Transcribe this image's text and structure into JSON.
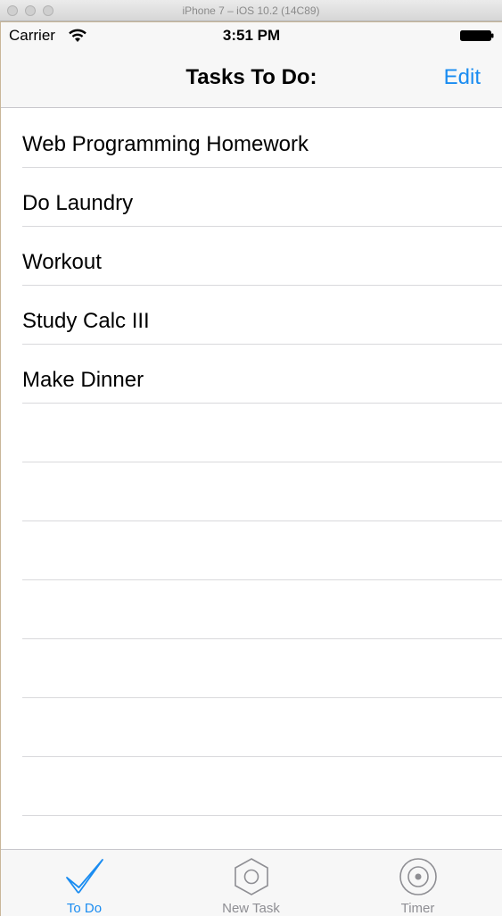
{
  "simulator": {
    "title": "iPhone 7 – iOS 10.2 (14C89)"
  },
  "status_bar": {
    "carrier": "Carrier",
    "time": "3:51 PM"
  },
  "nav_bar": {
    "title": "Tasks To Do:",
    "edit_label": "Edit"
  },
  "tasks": [
    "Web Programming Homework",
    "Do Laundry",
    "Workout",
    "Study Calc III",
    "Make Dinner"
  ],
  "tab_bar": {
    "tabs": [
      {
        "label": "To Do",
        "icon": "checkmark-icon",
        "active": true
      },
      {
        "label": "New Task",
        "icon": "hexagon-icon",
        "active": false
      },
      {
        "label": "Timer",
        "icon": "target-icon",
        "active": false
      }
    ]
  },
  "colors": {
    "accent": "#1a8cf1",
    "inactive_tab": "#8e8e93",
    "separator": "#d9d9dc",
    "bar_background": "#f7f7f7"
  }
}
